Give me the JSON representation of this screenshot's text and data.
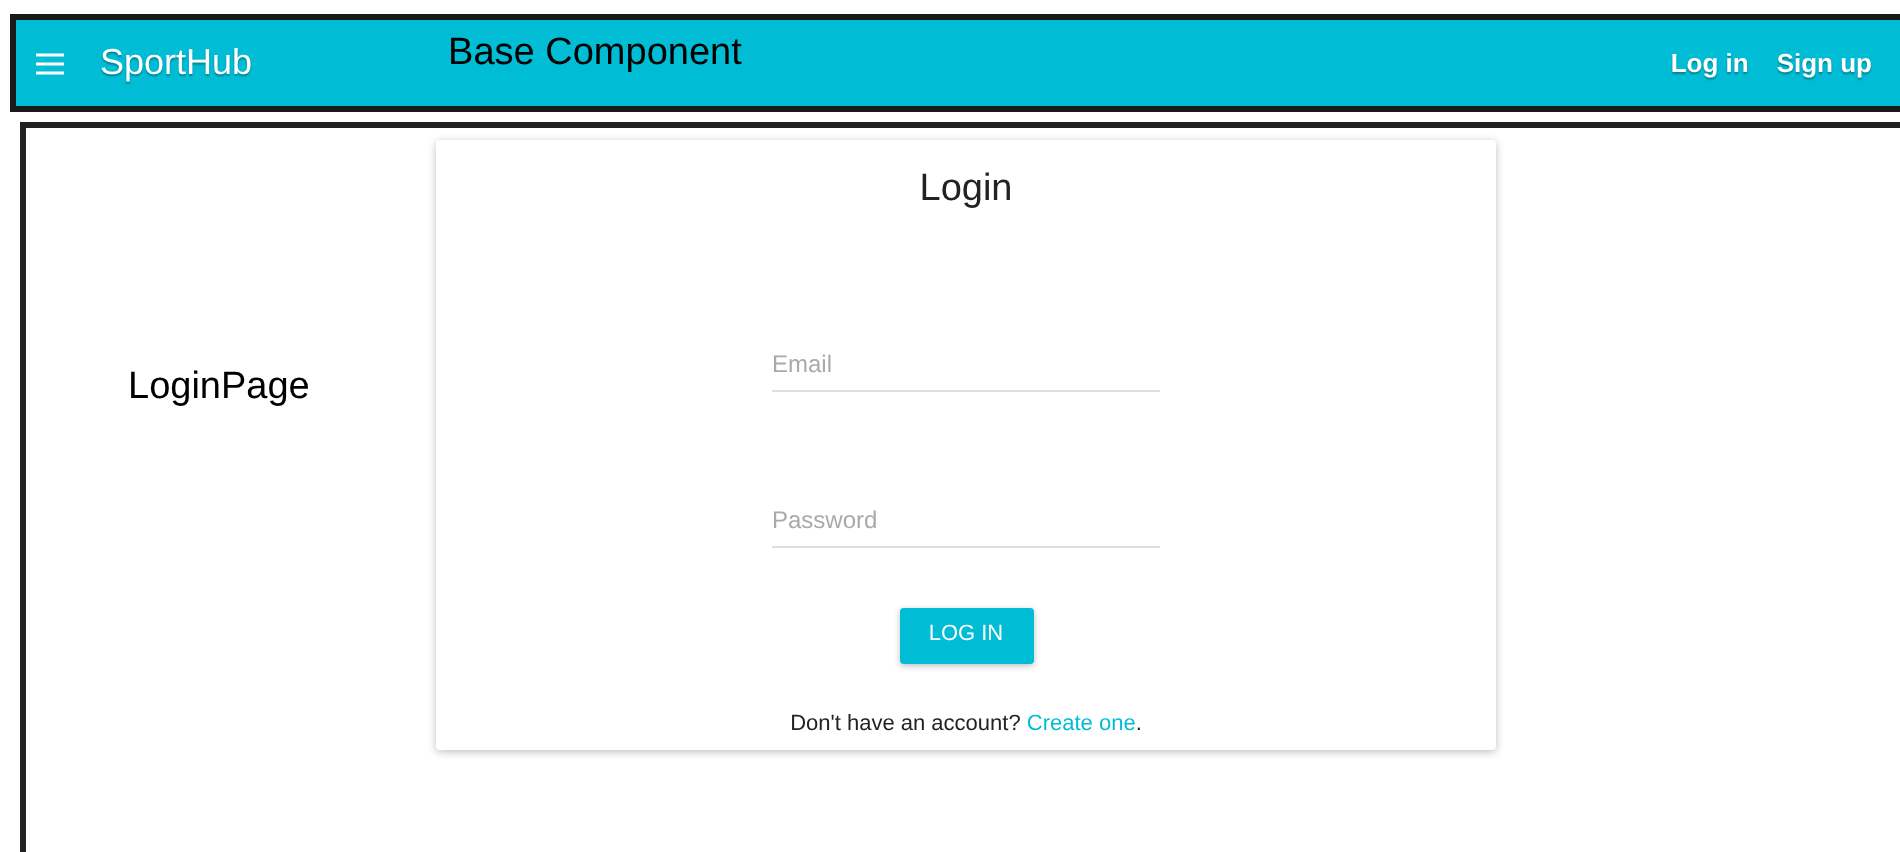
{
  "app_bar": {
    "brand": "SportHub",
    "annotation": "Base Component",
    "links": [
      "Log in",
      "Sign up"
    ]
  },
  "page_annotation": "LoginPage",
  "login_card": {
    "title": "Login",
    "fields": [
      {
        "placeholder": "Email"
      },
      {
        "placeholder": "Password"
      }
    ],
    "button": "LOG IN",
    "footer": {
      "text": "Don't have an account?",
      "link": "Create one",
      "end": "."
    }
  }
}
